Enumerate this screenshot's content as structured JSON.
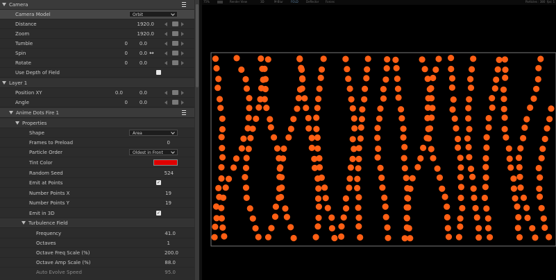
{
  "topbar": {
    "zoom": "75%",
    "render_view": "Render View",
    "mode_3d": "3D",
    "mode_mblur": "M-Blur",
    "mode_fold": "FOLD",
    "deflector": "Deflector",
    "forces": "Forces",
    "particles": "Particles : 380",
    "fps": "fps: 1"
  },
  "panel": {
    "camera": {
      "title": "Camera",
      "model_label": "Camera Model",
      "model_value": "Orbit",
      "distance_label": "Distance",
      "distance_value": "1920.0",
      "zoom_label": "Zoom",
      "zoom_value": "1920.0",
      "tumble_label": "Tumble",
      "tumble_a": "0",
      "tumble_b": "0.0",
      "spin_label": "Spin",
      "spin_a": "0",
      "spin_b": "0.0",
      "rotate_label": "Rotate",
      "rotate_a": "0",
      "rotate_b": "0.0",
      "dof_label": "Use Depth of Field"
    },
    "layer1": {
      "title": "Layer 1",
      "position_label": "Position XY",
      "position_x": "0.0",
      "position_y": "0.0",
      "angle_label": "Angle",
      "angle_a": "0",
      "angle_b": "0.0"
    },
    "effect": {
      "title": "Anime Dots Fire 1",
      "properties_label": "Properties",
      "shape_label": "Shape",
      "shape_value": "Area",
      "frames_label": "Frames to Preload",
      "frames_value": "0",
      "order_label": "Particle Order",
      "order_value": "Oldest in Front",
      "tint_label": "Tint Color",
      "tint_color": "#e00000",
      "seed_label": "Random Seed",
      "seed_value": "524",
      "emit_points_label": "Emit at Points",
      "emit_points_check": "✓",
      "nx_label": "Number Points X",
      "nx_value": "19",
      "ny_label": "Number Points Y",
      "ny_value": "19",
      "emit3d_label": "Emit in 3D",
      "emit3d_check": "✓",
      "turbulence_label": "Turbulence Field",
      "frequency_label": "Frequency",
      "frequency_value": "41.0",
      "octaves_label": "Octaves",
      "octaves_value": "1",
      "ofs_label": "Octave Freq Scale (%)",
      "ofs_value": "200.0",
      "oas_label": "Octave Amp Scale (%)",
      "oas_value": "88.0",
      "aes_label": "Auto Evolve Speed",
      "aes_value": "95.0"
    }
  },
  "viewport": {
    "particle_color": "#ff5f14",
    "frame_color": "#7a7a7a"
  }
}
